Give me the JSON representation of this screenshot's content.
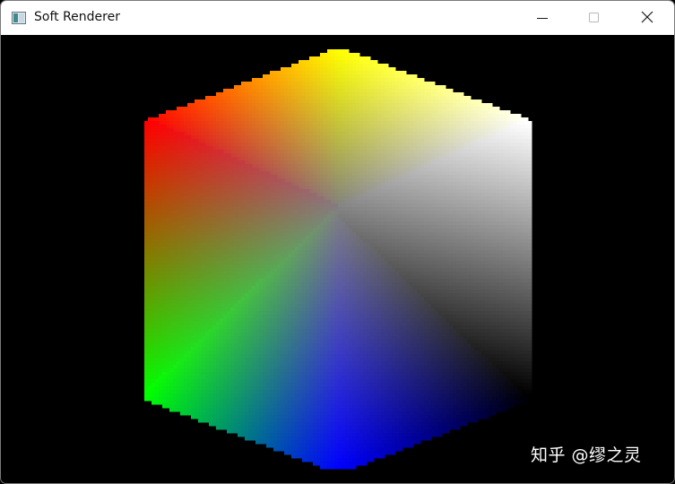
{
  "window": {
    "title": "Soft Renderer"
  },
  "titlebar": {
    "icons": {
      "app": "app-window-icon",
      "minimize": "minimize-icon",
      "maximize": "maximize-icon",
      "close": "close-icon"
    }
  },
  "scene": {
    "object": "rgb-color-cube",
    "vertex_colors": {
      "top": "#ffff00",
      "upper_left": "#ff0000",
      "upper_right": "#ffffff",
      "center": "#808080",
      "lower_left": "#00ff00",
      "lower_right": "#000000",
      "bottom": "#0000ff"
    }
  },
  "watermark": {
    "text": "知乎 @缪之灵"
  }
}
